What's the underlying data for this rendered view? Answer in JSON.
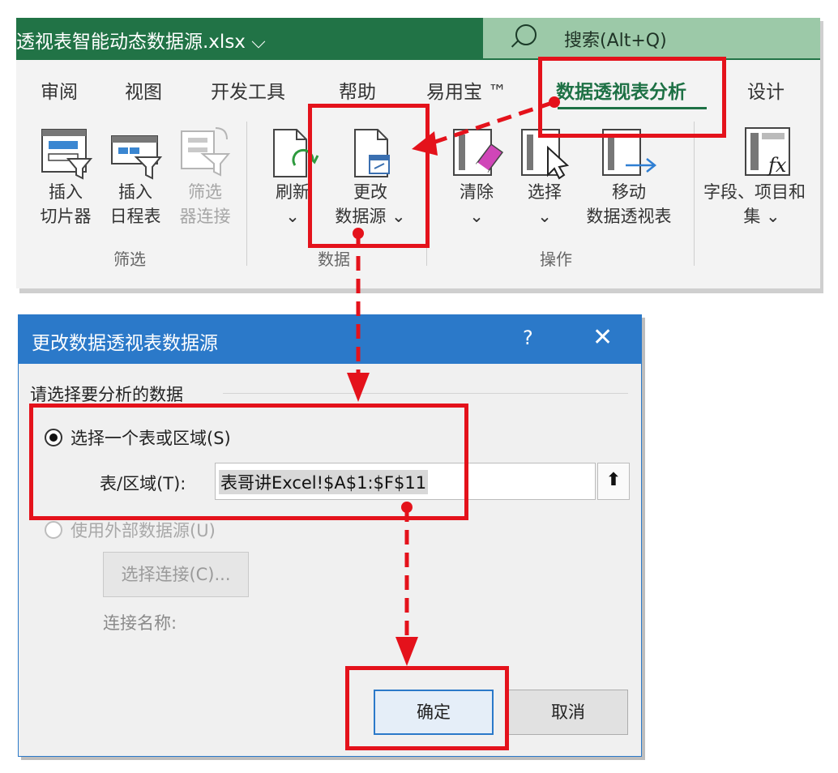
{
  "window": {
    "title": "透视表智能动态数据源.xlsx ⌵",
    "search_placeholder": "搜索(Alt+Q)"
  },
  "ribbon_tabs": [
    {
      "label": "审阅"
    },
    {
      "label": "视图"
    },
    {
      "label": "开发工具"
    },
    {
      "label": "帮助"
    },
    {
      "label": "易用宝 ™"
    },
    {
      "label": "数据透视表分析",
      "active": true
    },
    {
      "label": "设计"
    }
  ],
  "ribbon": {
    "insert_slicer": [
      "插入",
      "切片器"
    ],
    "insert_timeline": [
      "插入",
      "日程表"
    ],
    "filter_connections": [
      "筛选",
      "器连接"
    ],
    "group_filter": "筛选",
    "refresh": [
      "刷新",
      "⌄"
    ],
    "change_source": [
      "更改",
      "数据源 ⌄"
    ],
    "group_data": "数据",
    "clear": [
      "清除",
      "⌄"
    ],
    "select": [
      "选择",
      "⌄"
    ],
    "move": [
      "移动",
      "数据透视表"
    ],
    "group_actions": "操作",
    "fields_items": [
      "字段、项目和",
      "集 ⌄"
    ]
  },
  "dialog": {
    "title": "更改数据透视表数据源",
    "help": "?",
    "close": "✕",
    "section_label": "请选择要分析的数据",
    "option_table": "选择一个表或区域(S)",
    "range_label": "表/区域(T):",
    "range_value": "表哥讲Excel!$A$1:$F$11",
    "collapse_symbol": "⬆",
    "option_external": "使用外部数据源(U)",
    "choose_connection": "选择连接(C)...",
    "connection_name_label": "连接名称:",
    "ok": "确定",
    "cancel": "取消"
  },
  "colors": {
    "excel_green": "#217346",
    "dialog_blue": "#2b79c9",
    "annotation_red": "#e4121b"
  }
}
